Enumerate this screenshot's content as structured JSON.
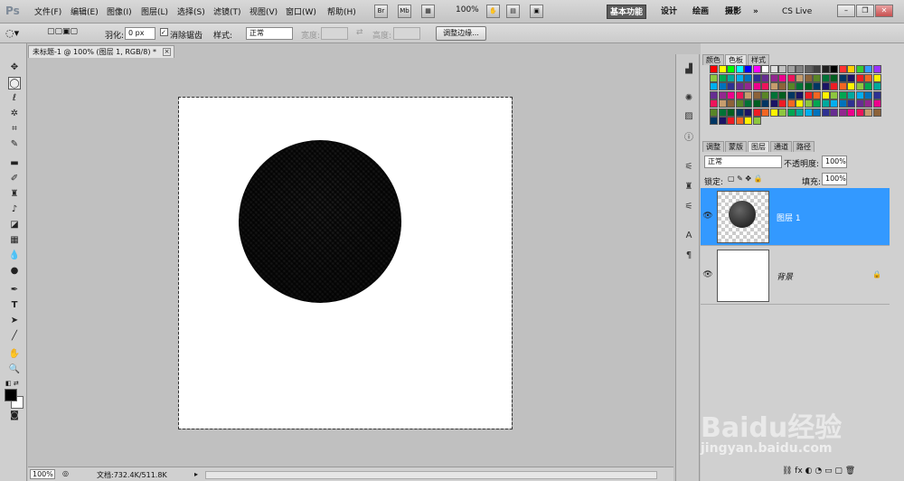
{
  "app": {
    "logo": "Ps"
  },
  "menu": [
    "文件(F)",
    "编辑(E)",
    "图像(I)",
    "图层(L)",
    "选择(S)",
    "滤镜(T)",
    "视图(V)",
    "窗口(W)",
    "帮助(H)"
  ],
  "top_toolbar": {
    "br": "Br",
    "mb": "Mb",
    "zoom": "100%"
  },
  "workspaces": {
    "active": "基本功能",
    "items": [
      "设计",
      "绘画",
      "摄影"
    ],
    "more": "»",
    "cslive": "CS Live"
  },
  "options": {
    "feather_label": "羽化:",
    "feather_value": "0 px",
    "antialias_label": "消除锯齿",
    "style_label": "样式:",
    "style_value": "正常",
    "width_label": "宽度:",
    "height_label": "高度:",
    "refine_edge": "调整边缘..."
  },
  "document": {
    "tab_title": "未标题-1 @ 100% (图层 1, RGB/8) *",
    "close": "×"
  },
  "status": {
    "zoom": "100%",
    "doc_info": "文档:732.4K/511.8K"
  },
  "panels": {
    "swatch_tabs": [
      "颜色",
      "色板",
      "样式"
    ],
    "layer_tabs": [
      "调整",
      "蒙版",
      "图层",
      "通道",
      "路径"
    ],
    "blend_mode": "正常",
    "opacity_label": "不透明度:",
    "opacity_value": "100%",
    "lock_label": "锁定:",
    "fill_label": "填充:",
    "fill_value": "100%",
    "layers": [
      {
        "name": "图层 1"
      },
      {
        "name": "背景"
      }
    ]
  },
  "watermark": {
    "brand": "Baidu经验",
    "url": "jingyan.baidu.com"
  }
}
